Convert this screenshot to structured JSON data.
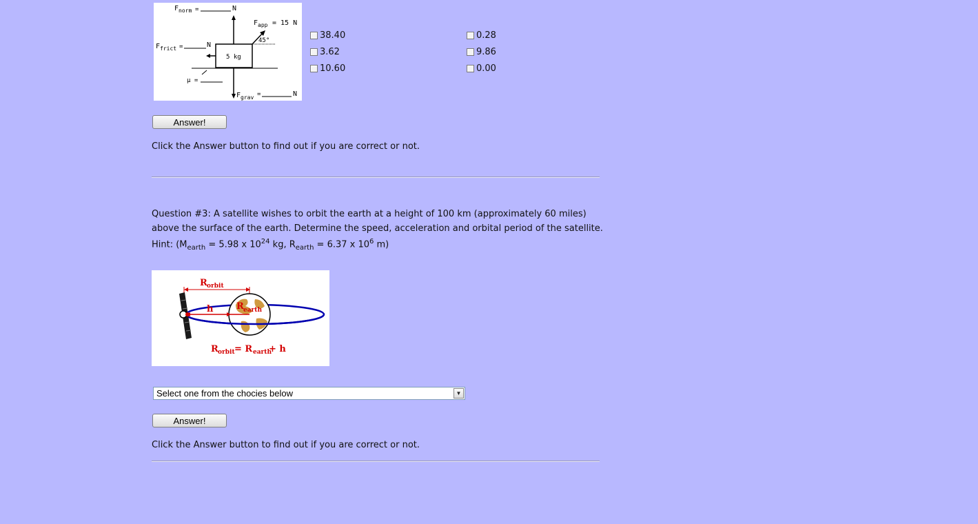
{
  "q2": {
    "diagram": {
      "fnorm": "F",
      "fnorm_sub": "norm",
      "fnorm_eq": "=",
      "unit_n": "N",
      "fapp": "F",
      "fapp_sub": "app",
      "fapp_val": "= 15  N",
      "angle": "45°",
      "ffrict": "F",
      "ffrict_sub": "frict",
      "ffrict_eq": "=",
      "mass": "5 kg",
      "mu": "μ =",
      "fgrav": "F",
      "fgrav_sub": "grav",
      "fgrav_eq": "="
    },
    "options_left": [
      "38.40",
      "3.62",
      "10.60"
    ],
    "options_right": [
      "0.28",
      "9.86",
      "0.00"
    ],
    "answer_label": "Answer!",
    "feedback": "Click the Answer button to find out if you are correct or not."
  },
  "q3": {
    "question": "Question #3: A satellite wishes to orbit the earth at a height of 100 km (approximately 60 miles) above the surface of the earth. Determine the speed, acceleration and orbital period of the satellite.",
    "hint_prefix": "Hint: (M",
    "hint_sub1": "earth",
    "hint_mid1": " = 5.98 x 10",
    "hint_sup1": "24",
    "hint_mid2": " kg, R",
    "hint_sub2": "earth",
    "hint_mid3": " = 6.37 x 10",
    "hint_sup2": "6",
    "hint_end": " m)",
    "diagram": {
      "r_orbit": "R",
      "r_orbit_sub": "orbit",
      "h": "h",
      "r_earth": "R",
      "r_earth_sub": "earth",
      "eq_r": "R",
      "eq_r_sub": "orbit",
      "eq_eq": " = R",
      "eq_earth_sub": "earth",
      "eq_plus": " + h"
    },
    "select_value": "Select one from the chocies below",
    "answer_label": "Answer!",
    "feedback": "Click the Answer button to find out if you are correct or not."
  },
  "colors": {
    "background": "#b8b8ff",
    "diagram_red": "#d40000",
    "orbit_blue": "#0000b0",
    "earth_tan": "#d09a40"
  }
}
